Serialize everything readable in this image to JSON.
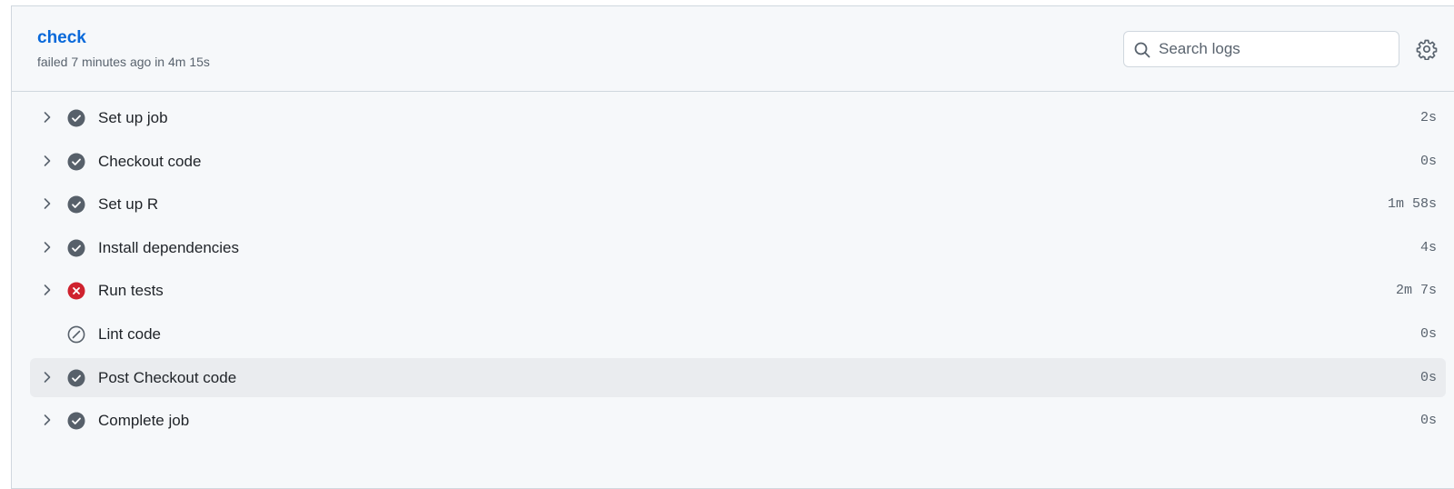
{
  "job": {
    "title": "check",
    "subtitle": "failed 7 minutes ago in 4m 15s"
  },
  "search": {
    "placeholder": "Search logs",
    "value": ""
  },
  "colors": {
    "link": "#0969da",
    "success_icon": "#57606a",
    "failure_icon": "#cf222e",
    "skipped_icon": "#57606a"
  },
  "steps": [
    {
      "name": "Set up job",
      "duration": "2s",
      "status": "success",
      "icon": "check-circle-fill-icon",
      "expandable": true
    },
    {
      "name": "Checkout code",
      "duration": "0s",
      "status": "success",
      "icon": "check-circle-fill-icon",
      "expandable": true
    },
    {
      "name": "Set up R",
      "duration": "1m 58s",
      "status": "success",
      "icon": "check-circle-fill-icon",
      "expandable": true
    },
    {
      "name": "Install dependencies",
      "duration": "4s",
      "status": "success",
      "icon": "check-circle-fill-icon",
      "expandable": true
    },
    {
      "name": "Run tests",
      "duration": "2m 7s",
      "status": "failure",
      "icon": "x-circle-fill-icon",
      "expandable": true
    },
    {
      "name": "Lint code",
      "duration": "0s",
      "status": "skipped",
      "icon": "skip-icon",
      "expandable": false
    },
    {
      "name": "Post Checkout code",
      "duration": "0s",
      "status": "success",
      "icon": "check-circle-fill-icon",
      "expandable": true
    },
    {
      "name": "Complete job",
      "duration": "0s",
      "status": "success",
      "icon": "check-circle-fill-icon",
      "expandable": true
    }
  ]
}
